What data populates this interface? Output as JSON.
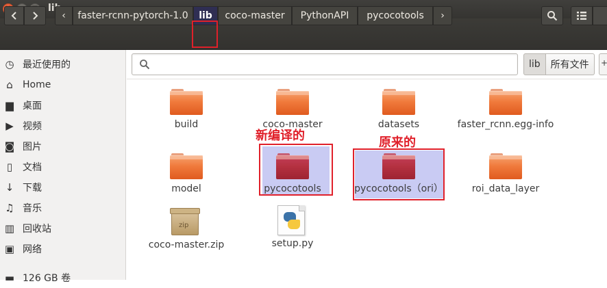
{
  "window": {
    "title": "lib",
    "close_glyph": "✕",
    "min_glyph": "–",
    "max_glyph": "□"
  },
  "toolbar": {
    "back_icon": "chevron-left-icon",
    "forward_icon": "chevron-right-icon",
    "breadcrumbs": [
      "faster-rcnn-pytorch-1.0",
      "lib",
      "coco-master",
      "PythonAPI",
      "pycocotools"
    ],
    "active_crumb": "lib",
    "crumb_left_glyph": "‹",
    "crumb_right_glyph": "›",
    "search_icon": "search-icon",
    "view_icon": "list-view-icon"
  },
  "sidebar": {
    "items": [
      {
        "label": "最近使用的",
        "icon": "clock-icon",
        "glyph": "◷"
      },
      {
        "label": "Home",
        "icon": "home-icon",
        "glyph": "⌂"
      },
      {
        "label": "桌面",
        "icon": "desktop-folder-icon",
        "glyph": "▆"
      },
      {
        "label": "视频",
        "icon": "video-icon",
        "glyph": "▶"
      },
      {
        "label": "图片",
        "icon": "camera-icon",
        "glyph": "◙"
      },
      {
        "label": "文档",
        "icon": "document-icon",
        "glyph": "▯"
      },
      {
        "label": "下载",
        "icon": "download-icon",
        "glyph": "↓"
      },
      {
        "label": "音乐",
        "icon": "music-icon",
        "glyph": "♫"
      },
      {
        "label": "回收站",
        "icon": "trash-icon",
        "glyph": "▥"
      },
      {
        "label": "网络",
        "icon": "network-icon",
        "glyph": "▣"
      },
      {
        "label": "126 GB 卷",
        "icon": "drive-icon",
        "glyph": "▬"
      }
    ]
  },
  "search": {
    "value": "",
    "placeholder": "",
    "scopes": [
      "lib",
      "所有文件"
    ],
    "active_scope": "lib",
    "more_glyph": "+"
  },
  "files": [
    {
      "name": "build",
      "type": "folder"
    },
    {
      "name": "coco-master",
      "type": "folder"
    },
    {
      "name": "datasets",
      "type": "folder"
    },
    {
      "name": "faster_rcnn.egg-info",
      "type": "folder"
    },
    {
      "name": "model",
      "type": "folder"
    },
    {
      "name": "pycocotools",
      "type": "folder",
      "selected": true
    },
    {
      "name": "pycocotools（ori）",
      "type": "folder",
      "selected": true
    },
    {
      "name": "roi_data_layer",
      "type": "folder"
    },
    {
      "name": "coco-master.zip",
      "type": "zip",
      "icon_text": "zip"
    },
    {
      "name": "setup.py",
      "type": "python"
    }
  ],
  "annotations": {
    "new_compiled": "新编译的",
    "original": "原来的",
    "color": "#e0202a"
  },
  "colors": {
    "selection": "#c9cbf3",
    "folder_orange": "#f07a3c",
    "active_crumb_bg": "#2f2e53"
  }
}
